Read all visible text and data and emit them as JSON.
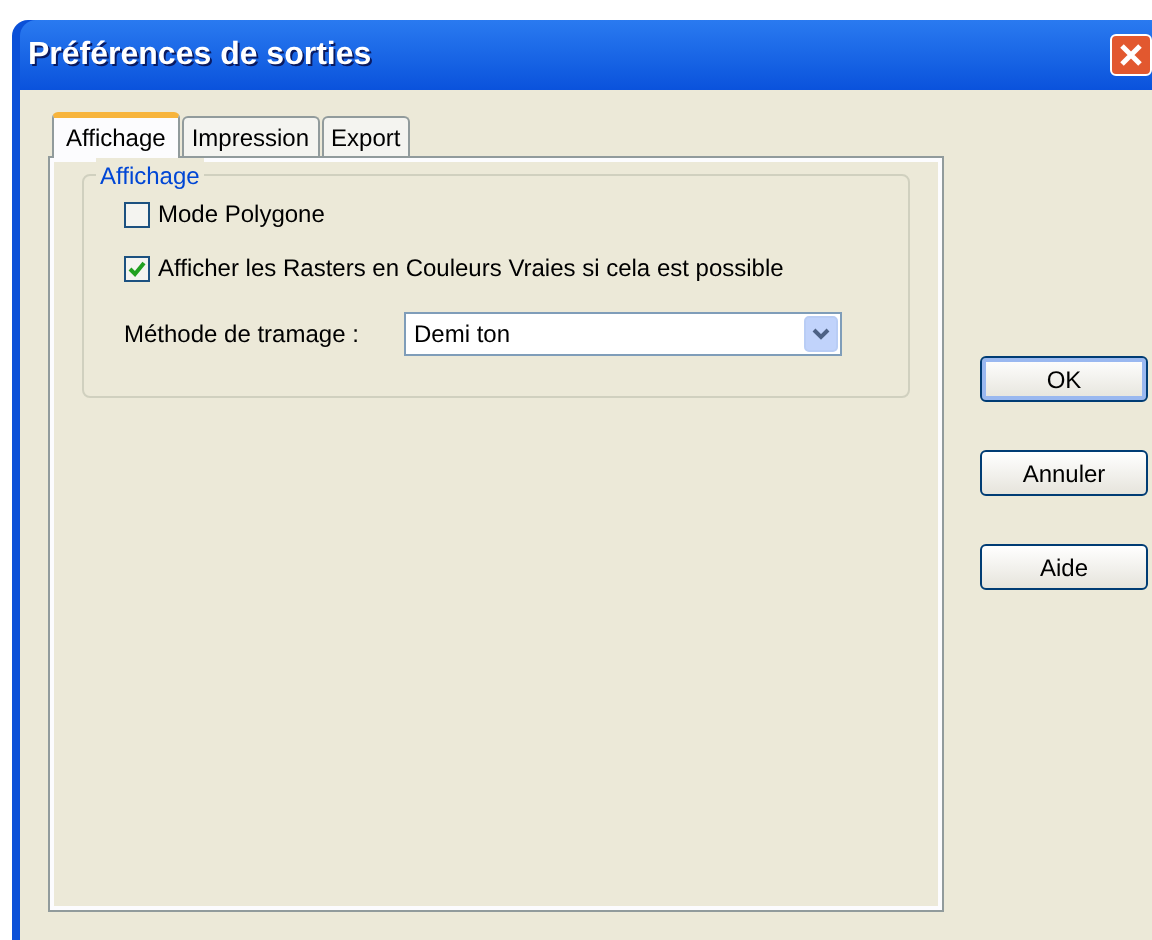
{
  "window": {
    "title": "Préférences de sorties"
  },
  "tabs": [
    {
      "label": "Affichage",
      "selected": true
    },
    {
      "label": "Impression",
      "selected": false
    },
    {
      "label": "Export",
      "selected": false
    }
  ],
  "group": {
    "title": "Affichage",
    "options": [
      {
        "label": "Mode Polygone",
        "checked": false
      },
      {
        "label": "Afficher les Rasters en Couleurs Vraies si cela est possible",
        "checked": true
      }
    ],
    "dither": {
      "label": "Méthode de tramage :",
      "value": "Demi ton"
    }
  },
  "buttons": [
    {
      "label": "OK",
      "default": true
    },
    {
      "label": "Annuler",
      "default": false
    },
    {
      "label": "Aide",
      "default": false
    }
  ]
}
